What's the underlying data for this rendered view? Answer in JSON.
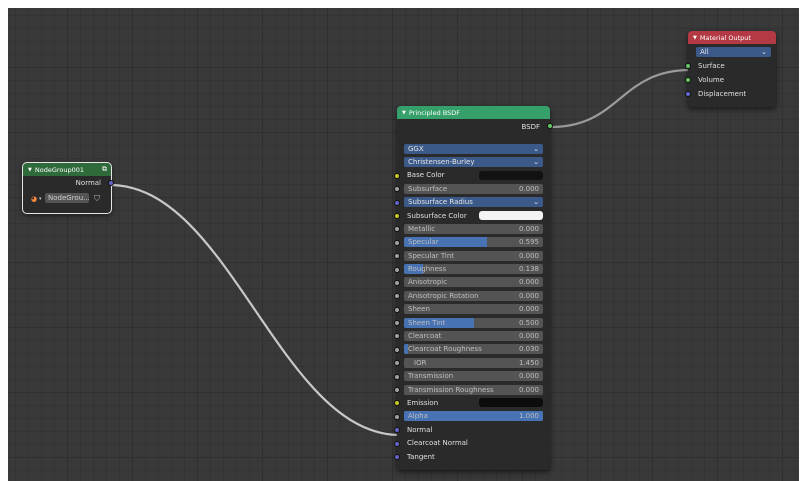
{
  "node_group": {
    "title": "NodeGroup001",
    "output_label": "Normal",
    "datablock_label": "NodeGrou...",
    "header_color": "#2f6a3a"
  },
  "principled": {
    "title": "Principled BSDF",
    "output_label": "BSDF",
    "distribution": "GGX",
    "subsurface_method": "Christensen-Burley",
    "header_color": "#36a06b",
    "inputs": [
      {
        "label": "Base Color",
        "kind": "color",
        "socket": "yellow",
        "color": "#121212"
      },
      {
        "label": "Subsurface",
        "kind": "value",
        "socket": "gray",
        "value": "0.000",
        "fill": 0
      },
      {
        "label": "Subsurface Radius",
        "kind": "vector",
        "socket": "purple"
      },
      {
        "label": "Subsurface Color",
        "kind": "color",
        "socket": "yellow",
        "color": "#f4f4f4"
      },
      {
        "label": "Metallic",
        "kind": "value",
        "socket": "gray",
        "value": "0.000",
        "fill": 0
      },
      {
        "label": "Specular",
        "kind": "value",
        "socket": "gray",
        "value": "0.595",
        "fill": 0.595
      },
      {
        "label": "Specular Tint",
        "kind": "value",
        "socket": "gray",
        "value": "0.000",
        "fill": 0
      },
      {
        "label": "Roughness",
        "kind": "value",
        "socket": "gray",
        "value": "0.138",
        "fill": 0.138
      },
      {
        "label": "Anisotropic",
        "kind": "value",
        "socket": "gray",
        "value": "0.000",
        "fill": 0
      },
      {
        "label": "Anisotropic Rotation",
        "kind": "value",
        "socket": "gray",
        "value": "0.000",
        "fill": 0
      },
      {
        "label": "Sheen",
        "kind": "value",
        "socket": "gray",
        "value": "0.000",
        "fill": 0
      },
      {
        "label": "Sheen Tint",
        "kind": "value",
        "socket": "gray",
        "value": "0.500",
        "fill": 0.5
      },
      {
        "label": "Clearcoat",
        "kind": "value",
        "socket": "gray",
        "value": "0.000",
        "fill": 0
      },
      {
        "label": "Clearcoat Roughness",
        "kind": "value",
        "socket": "gray",
        "value": "0.030",
        "fill": 0.03
      },
      {
        "label": "IOR",
        "kind": "number",
        "socket": "gray",
        "value": "1.450"
      },
      {
        "label": "Transmission",
        "kind": "value",
        "socket": "gray",
        "value": "0.000",
        "fill": 0
      },
      {
        "label": "Transmission Roughness",
        "kind": "value",
        "socket": "gray",
        "value": "0.000",
        "fill": 0
      },
      {
        "label": "Emission",
        "kind": "color",
        "socket": "yellow",
        "color": "#0c0c0c"
      },
      {
        "label": "Alpha",
        "kind": "value",
        "socket": "gray",
        "value": "1.000",
        "fill": 1
      },
      {
        "label": "Normal",
        "kind": "socket",
        "socket": "purple"
      },
      {
        "label": "Clearcoat Normal",
        "kind": "socket",
        "socket": "purple"
      },
      {
        "label": "Tangent",
        "kind": "socket",
        "socket": "purple"
      }
    ]
  },
  "material_output": {
    "title": "Material Output",
    "target": "All",
    "header_color": "#b33a44",
    "inputs": [
      {
        "label": "Surface",
        "socket": "green"
      },
      {
        "label": "Volume",
        "socket": "green"
      },
      {
        "label": "Displacement",
        "socket": "purple"
      }
    ]
  }
}
